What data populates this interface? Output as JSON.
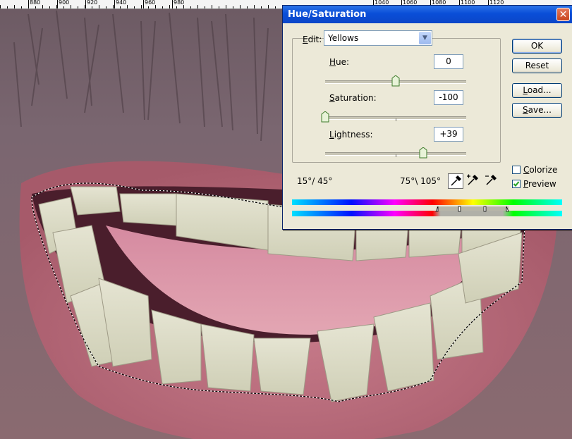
{
  "ruler": {
    "labels": [
      "880",
      "900",
      "920",
      "940",
      "960",
      "980",
      "1040",
      "1060",
      "1080",
      "1100",
      "1120"
    ]
  },
  "dialog": {
    "title": "Hue/Saturation",
    "close_glyph": "✕",
    "edit": {
      "label": "Edit:",
      "selected": "Yellows"
    },
    "hue": {
      "label": "Hue:",
      "value": "0",
      "slider_fraction": 0.5
    },
    "saturation": {
      "label": "Saturation:",
      "value": "-100",
      "slider_fraction": 0.0
    },
    "lightness": {
      "label": "Lightness:",
      "value": "+39",
      "slider_fraction": 0.695
    },
    "buttons": {
      "ok": "OK",
      "reset": "Reset",
      "load": "Load...",
      "save": "Save..."
    },
    "range_left": "15°/ 45°",
    "range_right": "75°\\ 105°",
    "colorize": {
      "label": "Colorize",
      "checked": false
    },
    "preview": {
      "label": "Preview",
      "checked": true
    },
    "icons": [
      "eyedropper-icon",
      "eyedropper-plus-icon",
      "eyedropper-minus-icon"
    ]
  },
  "colors": {
    "titlebar": "#0a4ed8",
    "dialog_bg": "#ece9d8",
    "lip": "#b5697a",
    "skin": "#6e5a60"
  }
}
